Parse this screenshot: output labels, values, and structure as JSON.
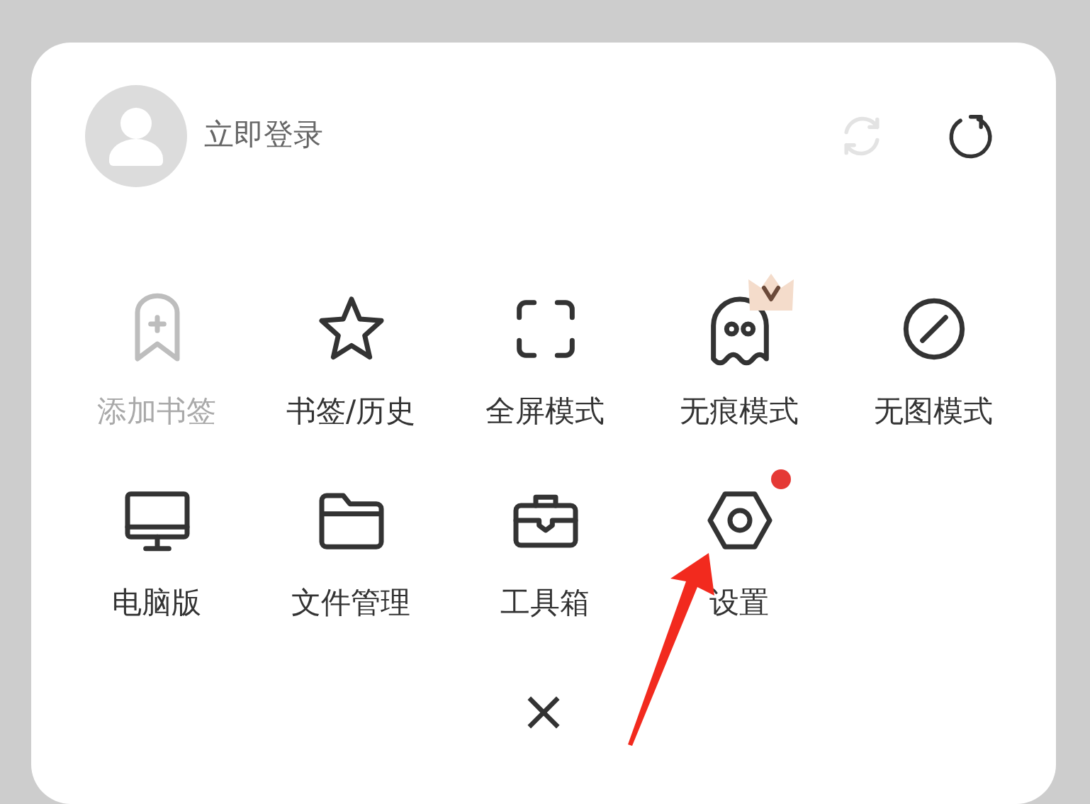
{
  "account": {
    "login_label": "立即登录"
  },
  "header_actions": [
    {
      "disabled": true
    },
    {
      "disabled": false
    }
  ],
  "menu_items": [
    {
      "label": "添加书签",
      "disabled": true,
      "vip_badge": false,
      "notification_dot": false
    },
    {
      "label": "书签/历史",
      "disabled": false,
      "vip_badge": false,
      "notification_dot": false
    },
    {
      "label": "全屏模式",
      "disabled": false,
      "vip_badge": false,
      "notification_dot": false
    },
    {
      "label": "无痕模式",
      "disabled": false,
      "vip_badge": true,
      "notification_dot": false
    },
    {
      "label": "无图模式",
      "disabled": false,
      "vip_badge": false,
      "notification_dot": false
    },
    {
      "label": "电脑版",
      "disabled": false,
      "vip_badge": false,
      "notification_dot": false
    },
    {
      "label": "文件管理",
      "disabled": false,
      "vip_badge": false,
      "notification_dot": false
    },
    {
      "label": "工具箱",
      "disabled": false,
      "vip_badge": false,
      "notification_dot": false
    },
    {
      "label": "设置",
      "disabled": false,
      "vip_badge": false,
      "notification_dot": true
    }
  ],
  "close_button": {
    "label": "×"
  }
}
